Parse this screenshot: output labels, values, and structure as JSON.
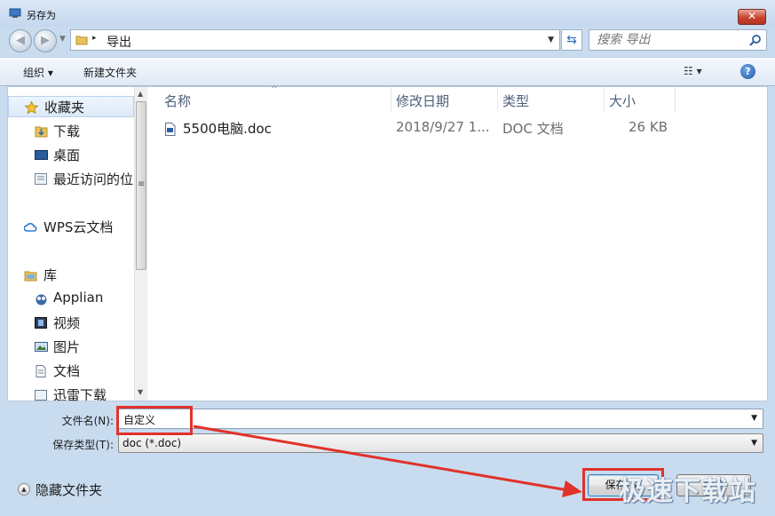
{
  "window": {
    "title": "另存为",
    "close_label": "✕"
  },
  "nav": {
    "back_icon": "back-arrow-icon",
    "forward_icon": "forward-arrow-icon",
    "path_separator": "▸",
    "path": "导出",
    "refresh_icon": "refresh-icon",
    "search_placeholder": "搜索 导出"
  },
  "toolbar": {
    "organize_label": "组织 ▾",
    "new_folder_label": "新建文件夹",
    "view_label": "☷ ▾",
    "help_label": "?"
  },
  "sidebar": {
    "items": [
      {
        "label": "收藏夹",
        "icon": "star-icon"
      },
      {
        "label": "下载",
        "icon": "download-folder-icon"
      },
      {
        "label": "桌面",
        "icon": "desktop-icon"
      },
      {
        "label": "最近访问的位置",
        "icon": "recent-places-icon"
      },
      {
        "label": "WPS云文档",
        "icon": "cloud-icon"
      },
      {
        "label": "库",
        "icon": "library-icon"
      },
      {
        "label": "Applian",
        "icon": "owl-icon"
      },
      {
        "label": "视频",
        "icon": "video-icon"
      },
      {
        "label": "图片",
        "icon": "picture-icon"
      },
      {
        "label": "文档",
        "icon": "document-icon"
      },
      {
        "label": "迅雷下载",
        "icon": "download-icon"
      }
    ]
  },
  "file_list": {
    "columns": [
      "名称",
      "修改日期",
      "类型",
      "大小"
    ],
    "files": [
      {
        "name": "5500电脑.doc",
        "date": "2018/9/27 1...",
        "type": "DOC 文档",
        "size": "26 KB"
      }
    ]
  },
  "save_form": {
    "filename_label": "文件名(N):",
    "filename_value": "自定义",
    "filetype_label": "保存类型(T):",
    "filetype_value": "doc (*.doc)"
  },
  "footer": {
    "hide_folders_label": "隐藏文件夹",
    "save_label": "保存(S)",
    "cancel_label": "取消"
  },
  "annotations": {
    "highlight_color": "#e0322a"
  },
  "watermark": {
    "text": "极速下载站"
  }
}
